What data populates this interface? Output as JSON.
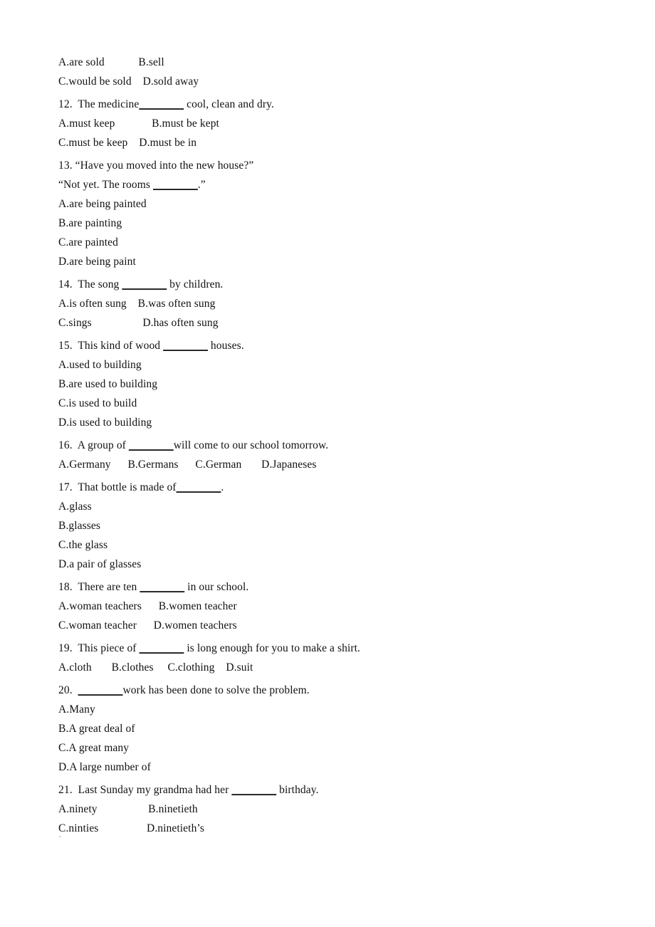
{
  "document": {
    "type": "english-grammar-multiple-choice-worksheet",
    "background_color": "#ffffff",
    "text_color": "#111111"
  },
  "lines": [
    {
      "id": "q11-opt-ab",
      "kind": "options",
      "text": "A.are sold            B.sell"
    },
    {
      "id": "q11-opt-cd",
      "kind": "options",
      "text": "C.would be sold    D.sold away"
    },
    {
      "id": "q12-stem",
      "kind": "stem",
      "pre": "12.  The medicine",
      "blank": "________",
      "post": " cool, clean and dry."
    },
    {
      "id": "q12-opt-ab",
      "kind": "options",
      "text": "A.must keep             B.must be kept"
    },
    {
      "id": "q12-opt-cd",
      "kind": "options",
      "text": "C.must be keep    D.must be in"
    },
    {
      "id": "q13-stem-1",
      "kind": "stem",
      "text": "13. “Have you moved into the new house?”"
    },
    {
      "id": "q13-stem-2",
      "kind": "stem",
      "pre": "“Not yet. The rooms ",
      "blank": "________",
      "post": ".”"
    },
    {
      "id": "q13-opt-a",
      "kind": "options",
      "text": "A.are being painted"
    },
    {
      "id": "q13-opt-b",
      "kind": "options",
      "text": "B.are painting"
    },
    {
      "id": "q13-opt-c",
      "kind": "options",
      "text": "C.are painted"
    },
    {
      "id": "q13-opt-d",
      "kind": "options",
      "text": "D.are being paint"
    },
    {
      "id": "q14-stem",
      "kind": "stem",
      "pre": "14.  The song ",
      "blank": "________",
      "post": " by children."
    },
    {
      "id": "q14-opt-ab",
      "kind": "options",
      "text": "A.is often sung    B.was often sung"
    },
    {
      "id": "q14-opt-cd",
      "kind": "options",
      "text": "C.sings                  D.has often sung"
    },
    {
      "id": "q15-stem",
      "kind": "stem",
      "pre": "15.  This kind of wood ",
      "blank": "________",
      "post": " houses."
    },
    {
      "id": "q15-opt-a",
      "kind": "options",
      "text": "A.used to building"
    },
    {
      "id": "q15-opt-b",
      "kind": "options",
      "text": "B.are used to building"
    },
    {
      "id": "q15-opt-c",
      "kind": "options",
      "text": "C.is used to build"
    },
    {
      "id": "q15-opt-d",
      "kind": "options",
      "text": "D.is used to building"
    },
    {
      "id": "q16-stem",
      "kind": "stem",
      "pre": "16.  A group of ",
      "blank": "________",
      "post": "will come to our school tomorrow."
    },
    {
      "id": "q16-opt-abcd",
      "kind": "options",
      "text": "A.Germany      B.Germans      C.German       D.Japaneses"
    },
    {
      "id": "q17-stem",
      "kind": "stem",
      "pre": "17.  That bottle is made of",
      "blank": "________",
      "post": "."
    },
    {
      "id": "q17-opt-a",
      "kind": "options",
      "text": "A.glass"
    },
    {
      "id": "q17-opt-b",
      "kind": "options",
      "text": "B.glasses"
    },
    {
      "id": "q17-opt-c",
      "kind": "options",
      "text": "C.the glass"
    },
    {
      "id": "q17-opt-d",
      "kind": "options",
      "text": "D.a pair of glasses"
    },
    {
      "id": "q18-stem",
      "kind": "stem",
      "pre": "18.  There are ten ",
      "blank": "________",
      "post": " in our school."
    },
    {
      "id": "q18-opt-ab",
      "kind": "options",
      "text": "A.woman teachers      B.women teacher"
    },
    {
      "id": "q18-opt-cd",
      "kind": "options",
      "text": "C.woman teacher      D.women teachers"
    },
    {
      "id": "q19-stem",
      "kind": "stem",
      "pre": "19.  This piece of ",
      "blank": "________",
      "post": " is long enough for you to make a shirt."
    },
    {
      "id": "q19-opt-abcd",
      "kind": "options",
      "text": "A.cloth       B.clothes     C.clothing    D.suit"
    },
    {
      "id": "q20-stem",
      "kind": "stem",
      "pre": "20.  ",
      "blank": "________",
      "post": "work has been done to solve the problem."
    },
    {
      "id": "q20-opt-a",
      "kind": "options",
      "text": "A.Many"
    },
    {
      "id": "q20-opt-b",
      "kind": "options",
      "text": "B.A great deal of"
    },
    {
      "id": "q20-opt-c",
      "kind": "options",
      "text": "C.A great many"
    },
    {
      "id": "q20-opt-d",
      "kind": "options",
      "text": "D.A large number of"
    },
    {
      "id": "q21-stem",
      "kind": "stem",
      "pre": "21.  Last Sunday my grandma had her ",
      "blank": "________",
      "post": " birthday."
    },
    {
      "id": "q21-opt-ab",
      "kind": "options",
      "text": "A.ninety                  B.ninetieth"
    },
    {
      "id": "q21-opt-cd",
      "kind": "options",
      "text": "C.ninties                 D.ninetieth’s"
    }
  ],
  "question_start_line_ids": [
    "q12-stem",
    "q13-stem-1",
    "q14-stem",
    "q15-stem",
    "q16-stem",
    "q17-stem",
    "q18-stem",
    "q19-stem",
    "q20-stem",
    "q21-stem"
  ]
}
